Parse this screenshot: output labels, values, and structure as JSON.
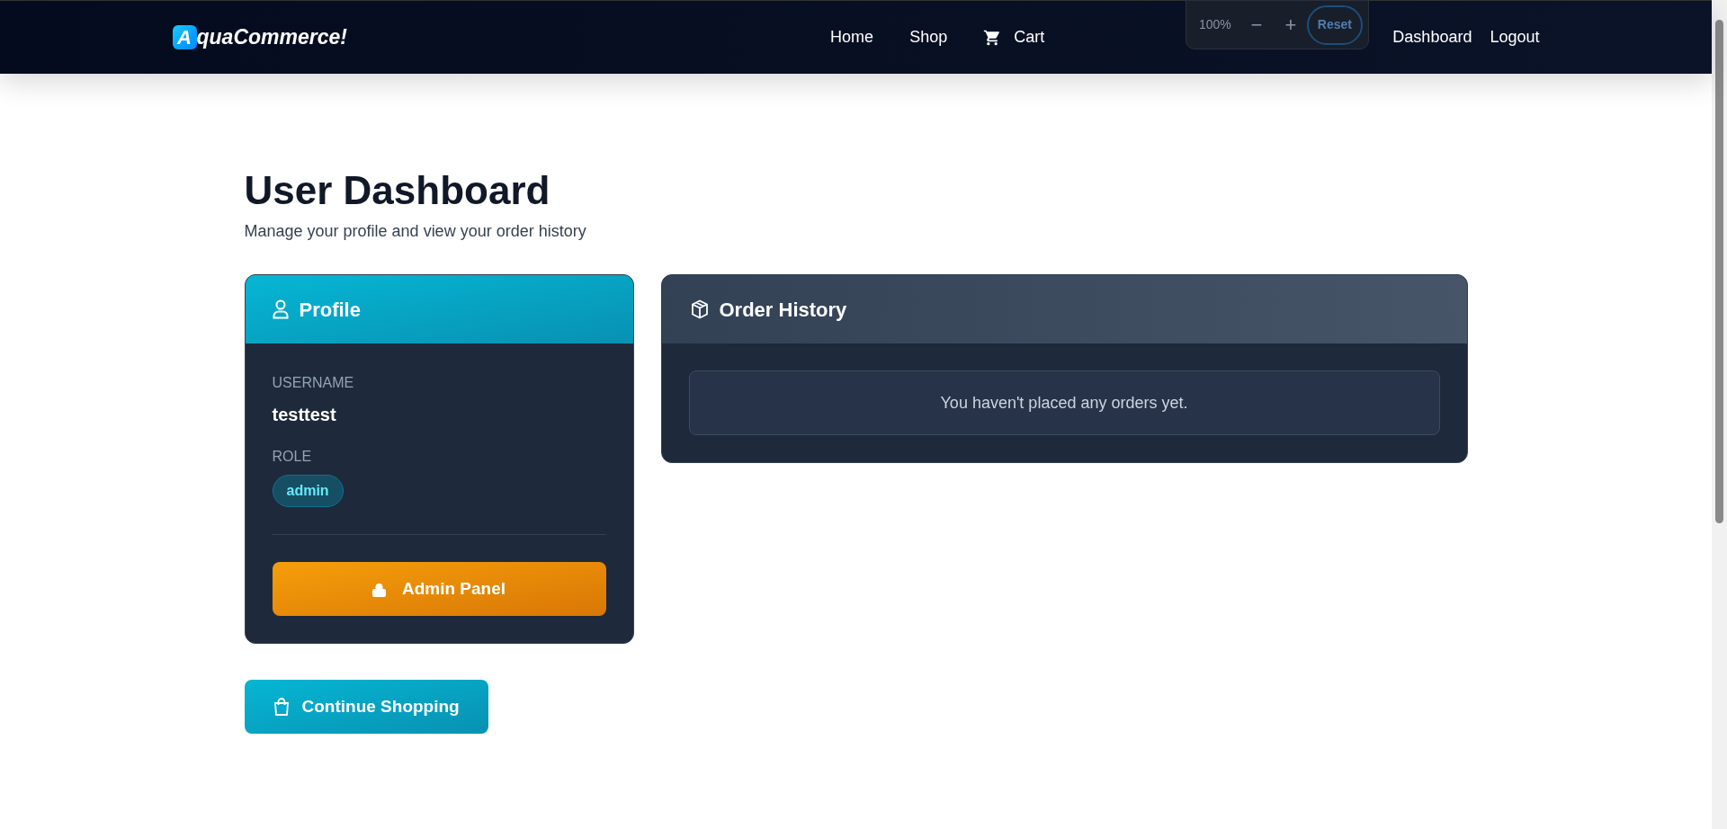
{
  "navbar": {
    "logo_letter": "A",
    "logo_text": "quaCommerce!",
    "links": [
      {
        "label": "Home",
        "kind": "text"
      },
      {
        "label": "Shop",
        "kind": "text"
      },
      {
        "label": "Cart",
        "kind": "cart"
      }
    ],
    "right_links": [
      "Dashboard",
      "Logout"
    ]
  },
  "zoom_popup": {
    "value": "100%",
    "decrease": "−",
    "increase": "+",
    "reset": "Reset"
  },
  "page": {
    "title": "User Dashboard",
    "subtitle": "Manage your profile and view your order history"
  },
  "profile": {
    "title": "Profile",
    "fields": [
      {
        "label": "USERNAME",
        "value": "testtest",
        "kind": "text"
      },
      {
        "label": "ROLE",
        "value": "admin",
        "kind": "badge"
      }
    ],
    "admin_button": "Admin Panel"
  },
  "order_history": {
    "title": "Order History",
    "empty_message": "You haven't placed any orders yet."
  },
  "continue_button": "Continue Shopping"
}
